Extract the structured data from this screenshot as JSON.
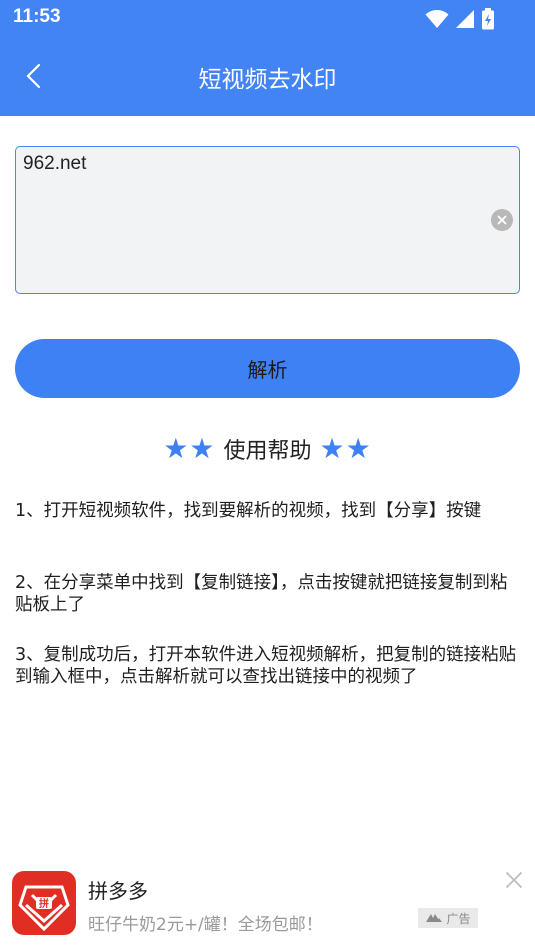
{
  "status_bar": {
    "time": "11:53",
    "icons": [
      "wifi-icon",
      "signal-icon",
      "battery-icon"
    ]
  },
  "header": {
    "title": "短视频去水印",
    "back_icon": "chevron-left-icon",
    "background_color": "#4384f5"
  },
  "input": {
    "value": "962.net",
    "clear_icon": "clear-circle-icon"
  },
  "parse_button": {
    "label": "解析",
    "color": "#3e81f5"
  },
  "help": {
    "stars_left": "★★",
    "title": "使用帮助",
    "stars_right": "★★",
    "items": [
      "1、打开短视频软件，找到要解析的视频，找到【分享】按键",
      "2、在分享菜单中找到【复制链接】，点击按键就把链接复制到粘贴板上了",
      "3、复制成功后，打开本软件进入短视频解析，把复制的链接粘贴到输入框中，点击解析就可以查找出链接中的视频了"
    ]
  },
  "ad": {
    "name": "拼多多",
    "description": "旺仔牛奶2元+/罐！全场包邮！",
    "badge": "广告",
    "logo_icon": "pinduoduo-logo",
    "close_icon": "close-icon"
  }
}
